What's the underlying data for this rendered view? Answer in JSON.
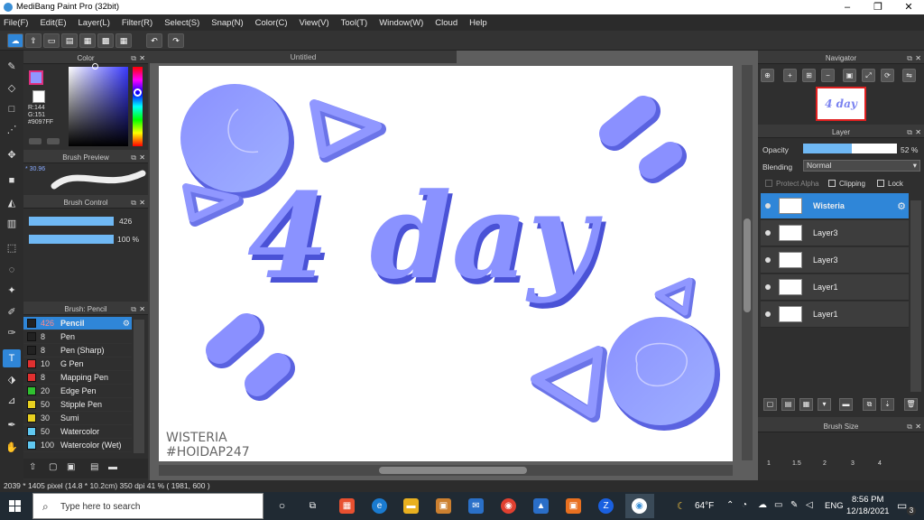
{
  "window": {
    "title": "MediBang Paint Pro (32bit)",
    "min": "–",
    "max": "❐",
    "close": "✕"
  },
  "menu": [
    "File(F)",
    "Edit(E)",
    "Layer(L)",
    "Filter(R)",
    "Select(S)",
    "Snap(N)",
    "Color(C)",
    "View(V)",
    "Tool(T)",
    "Window(W)",
    "Cloud",
    "Help"
  ],
  "document": {
    "title": "Untitled"
  },
  "color_panel": {
    "title": "Color",
    "r": "R:144",
    "g": "G:151",
    "hex": "#9097FF",
    "main_color": "#9097ff",
    "sub_color": "#ffffff"
  },
  "brush_preview": {
    "title": "Brush Preview",
    "size": "* 30.96"
  },
  "brush_control": {
    "title": "Brush Control",
    "size": "426",
    "opacity": "100 %"
  },
  "brush_list": {
    "title": "Brush: Pencil",
    "items": [
      {
        "size": "426",
        "name": "Pencil",
        "color": "#222222"
      },
      {
        "size": "8",
        "name": "Pen",
        "color": "#222222"
      },
      {
        "size": "8",
        "name": "Pen (Sharp)",
        "color": "#222222"
      },
      {
        "size": "10",
        "name": "G Pen",
        "color": "#e03030"
      },
      {
        "size": "8",
        "name": "Mapping Pen",
        "color": "#e03030"
      },
      {
        "size": "20",
        "name": "Edge Pen",
        "color": "#30c030"
      },
      {
        "size": "50",
        "name": "Stipple Pen",
        "color": "#e8d020"
      },
      {
        "size": "30",
        "name": "Sumi",
        "color": "#e8d020"
      },
      {
        "size": "50",
        "name": "Watercolor",
        "color": "#60c8f0"
      },
      {
        "size": "100",
        "name": "Watercolor (Wet)",
        "color": "#60c8f0"
      }
    ]
  },
  "artwork": {
    "text": "4 day",
    "signature1": "WISTERIA",
    "signature2": "#HOIDAP247"
  },
  "navigator": {
    "title": "Navigator",
    "thumb_text": "4 day"
  },
  "layer_panel": {
    "title": "Layer",
    "opacity_label": "Opacity",
    "opacity_value": "52 %",
    "opacity": 0.52,
    "blending_label": "Blending",
    "blending_value": "Normal",
    "protect_alpha": "Protect Alpha",
    "clipping": "Clipping",
    "lock": "Lock",
    "layers": [
      "Wisteria",
      "Layer3",
      "Layer3",
      "Layer1",
      "Layer1"
    ]
  },
  "brush_size": {
    "title": "Brush Size",
    "labels": [
      "1",
      "1.5",
      "2",
      "3",
      "4"
    ]
  },
  "status": {
    "text": "2039 * 1405 pixel  (14.8 * 10.2cm)  350 dpi  41 %  ( 1981, 600 )"
  },
  "taskbar": {
    "search_placeholder": "Type here to search",
    "weather": "64°F",
    "lang": "ENG",
    "time": "8:56 PM",
    "date": "12/18/2021",
    "notif": "3"
  },
  "colors": {
    "accent": "#2f86d8",
    "art_blue": "#6b74e8",
    "art_light": "#9097ff"
  }
}
